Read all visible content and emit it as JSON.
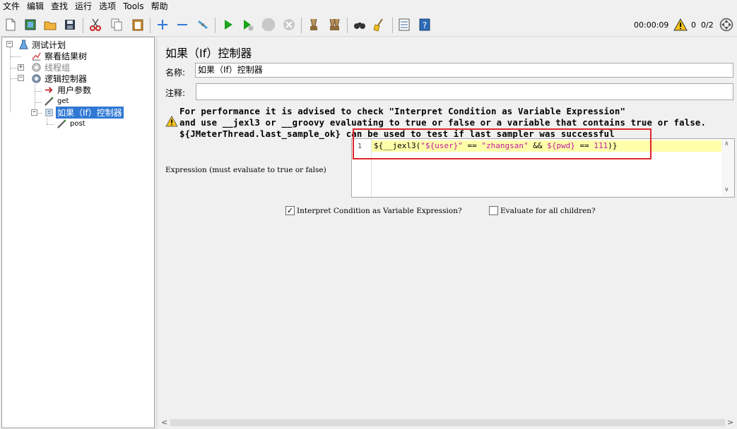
{
  "menu": [
    "文件",
    "编辑",
    "查找",
    "运行",
    "选项",
    "Tools",
    "帮助"
  ],
  "toolbar": {
    "icons": [
      "new-icon",
      "templates-icon",
      "open-icon",
      "save-icon",
      "cut-icon",
      "copy-icon",
      "paste-icon",
      "expand-icon",
      "collapse-icon",
      "toggle-icon",
      "start-icon",
      "start-no-pause-icon",
      "stop-icon",
      "shutdown-icon",
      "clear-icon",
      "clear-all-icon",
      "search-icon",
      "reset-search-icon",
      "function-helper-icon",
      "help-icon"
    ],
    "timer": "00:00:09",
    "warnings": "0",
    "threads": "0/2"
  },
  "tree": {
    "items": [
      {
        "label": "测试计划",
        "icon": "test-plan-icon"
      },
      {
        "label": "察看结果树",
        "icon": "view-results-tree-icon"
      },
      {
        "label": "线程组",
        "icon": "thread-group-icon",
        "disabled": true
      },
      {
        "label": "逻辑控制器",
        "icon": "thread-group-icon"
      },
      {
        "label": "用户参数",
        "icon": "user-parameters-icon"
      },
      {
        "label": "get",
        "icon": "sampler-icon"
      },
      {
        "label": "如果（If）控制器",
        "icon": "if-controller-icon",
        "selected": true
      },
      {
        "label": "post",
        "icon": "sampler-icon"
      }
    ]
  },
  "panel": {
    "title": "如果（If）控制器",
    "name_label": "名称:",
    "name_value": "如果（If）控制器",
    "comment_label": "注释:",
    "comment_value": "",
    "message_line1": "For performance it is advised to check \"Interpret Condition as Variable Expression\"",
    "message_line2": "and use __jexl3 or __groovy evaluating to true or false or a variable that contains true or false.",
    "message_line3": "${JMeterThread.last_sample_ok} can be used to test if last sampler was successful",
    "expression_label": "Expression (must evaluate to true or false)",
    "line_number": "1",
    "code_prefix": "${__jexl3(",
    "code_str1": "\"${user}\"",
    "code_op1": " == ",
    "code_str2": "\"zhangsan\"",
    "code_op2": " && ",
    "code_var": "${pwd}",
    "code_op3": " == ",
    "code_num": "111",
    "code_suffix": ")}",
    "interpret_label": "Interpret Condition as Variable Expression?",
    "interpret_checked": true,
    "evaluate_all_label": "Evaluate for all children?",
    "evaluate_all_checked": false
  },
  "colors": {
    "selection": "#2f78d4",
    "highlight_line": "#ffffaa",
    "string": "#c01aa0",
    "red_box": "#e0262b"
  }
}
